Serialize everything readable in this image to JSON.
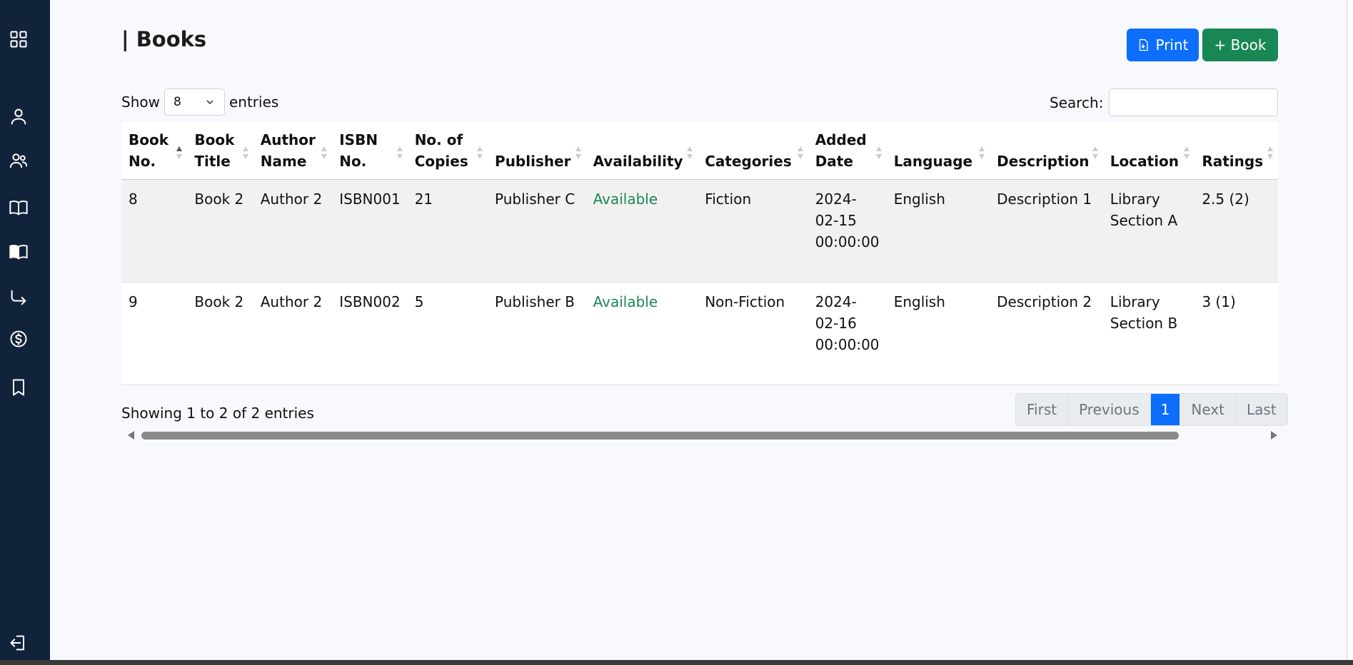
{
  "page": {
    "title": "| Books"
  },
  "toolbar": {
    "print_label": "Print",
    "add_label": "+ Book"
  },
  "length_menu": {
    "prefix": "Show",
    "value": "8",
    "suffix": "entries"
  },
  "search": {
    "label": "Search:",
    "value": "",
    "placeholder": ""
  },
  "sidebar": {
    "icons": [
      "dashboard-icon",
      "user-icon",
      "users-icon",
      "book-open-icon",
      "book-filled-icon",
      "return-arrow-icon",
      "dollar-icon",
      "bookmark-icon",
      "logout-icon"
    ]
  },
  "table": {
    "columns": [
      [
        "Book",
        "No."
      ],
      [
        "Book",
        "Title"
      ],
      [
        "Author",
        "Name"
      ],
      [
        "ISBN",
        "No."
      ],
      [
        "No. of",
        "Copies"
      ],
      [
        "",
        "Publisher"
      ],
      [
        "",
        "Availability"
      ],
      [
        "",
        "Categories"
      ],
      [
        "Added",
        "Date"
      ],
      [
        "",
        "Language"
      ],
      [
        "",
        "Description"
      ],
      [
        "",
        "Location"
      ],
      [
        "",
        "Ratings"
      ]
    ],
    "rows": [
      {
        "book_no": "8",
        "title": "Book 2",
        "author": "Author 2",
        "isbn": "ISBN001",
        "copies": "21",
        "publisher": "Publisher C",
        "availability": "Available",
        "category": "Fiction",
        "added_1": "2024-",
        "added_2": "02-15",
        "added_3": "00:00:00",
        "language": "English",
        "description": "Description 1",
        "location_1": "Library",
        "location_2": "Section A",
        "rating": "2.5 (2)"
      },
      {
        "book_no": "9",
        "title": "Book 2",
        "author": "Author 2",
        "isbn": "ISBN002",
        "copies": "5",
        "publisher": "Publisher B",
        "availability": "Available",
        "category": "Non-Fiction",
        "added_1": "2024-",
        "added_2": "02-16",
        "added_3": "00:00:00",
        "language": "English",
        "description": "Description 2",
        "location_1": "Library",
        "location_2": "Section B",
        "rating": "3 (1)"
      }
    ]
  },
  "footer": {
    "info": "Showing 1 to 2 of 2 entries"
  },
  "pagination": {
    "first": "First",
    "previous": "Previous",
    "current": "1",
    "next": "Next",
    "last": "Last"
  },
  "colors": {
    "sidebar": "#11233a",
    "primary": "#0d6efd",
    "success": "#198754"
  }
}
